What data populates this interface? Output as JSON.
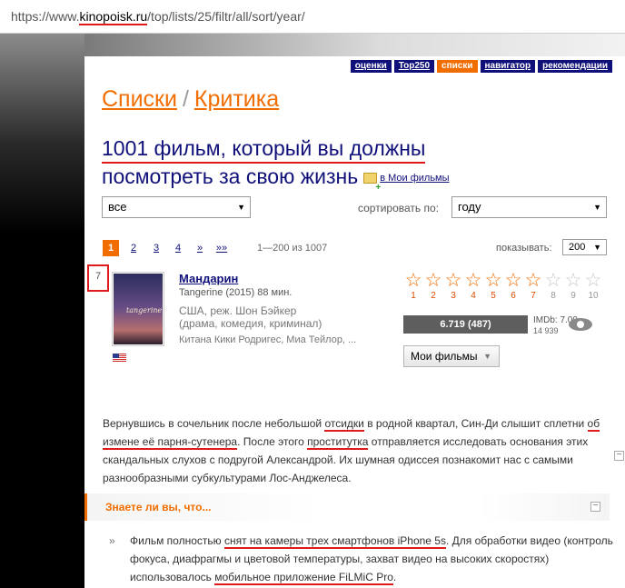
{
  "browser": {
    "url_scheme": "https://www.",
    "url_domain": "kinopoisk.ru",
    "url_path": "/top/lists/25/filtr/all/sort/year/"
  },
  "nav": {
    "items": [
      "оценки",
      "Top250",
      "списки",
      "навигатор",
      "рекомендации"
    ],
    "active": "списки"
  },
  "breadcrumbs": {
    "first": "Списки",
    "separator": "/",
    "second": "Критика"
  },
  "page": {
    "title_line1": "1001 фильм, который вы должны",
    "title_line2": "посмотреть за свою жизнь",
    "add_to_my": "в Мои фильмы"
  },
  "filters": {
    "filter_value": "все",
    "sort_label": "сортировать по:",
    "sort_value": "году"
  },
  "pagination": {
    "pages": [
      "1",
      "2",
      "3",
      "4",
      "»",
      "»»"
    ],
    "current": "1",
    "range": "1—200 из 1007",
    "show_label": "показывать:",
    "show_value": "200"
  },
  "movie": {
    "rank": "7",
    "title": "Мандарин",
    "original": "Tangerine (2015) 88 мин.",
    "country_director": "США, реж. Шон Бэйкер",
    "genres": "(драма, комедия, криминал)",
    "cast": "Китана Кики Родригес, Миа Тейлор, ...",
    "poster_text": "tangerine",
    "rating_button": "6.719 (487)",
    "imdb": "IMDb: 7.00",
    "imdb_votes": "14 939",
    "stars": [
      "1",
      "2",
      "3",
      "4",
      "5",
      "6",
      "7",
      "8",
      "9",
      "10"
    ],
    "stars_filled": 7,
    "my_movies": "Мои фильмы"
  },
  "description": "Вернувшись в сочельник после небольшой отсидки в родной квартал, Син-Ди слышит сплетни об измене её парня-сутенера. После этого проститутка отправляется исследовать основания этих скандальных слухов с подругой Александрой. Их шумная одиссея познакомит нас с самыми разнообразными субкультурами Лос-Анджелеса.",
  "did_you_know": {
    "heading": "Знаете ли вы, что...",
    "fact": "Фильм полностью снят на камеры трех смартфонов iPhone 5s. Для обработки видео (контроль фокуса, диафрагмы и цветовой температуры, захват видео на высоких скоростях) использовалось мобильное приложение FiLMiC Pro."
  },
  "colors": {
    "accent_orange": "#f26d00",
    "nav_blue": "#10107a",
    "annotation_red": "#e01b1b"
  }
}
